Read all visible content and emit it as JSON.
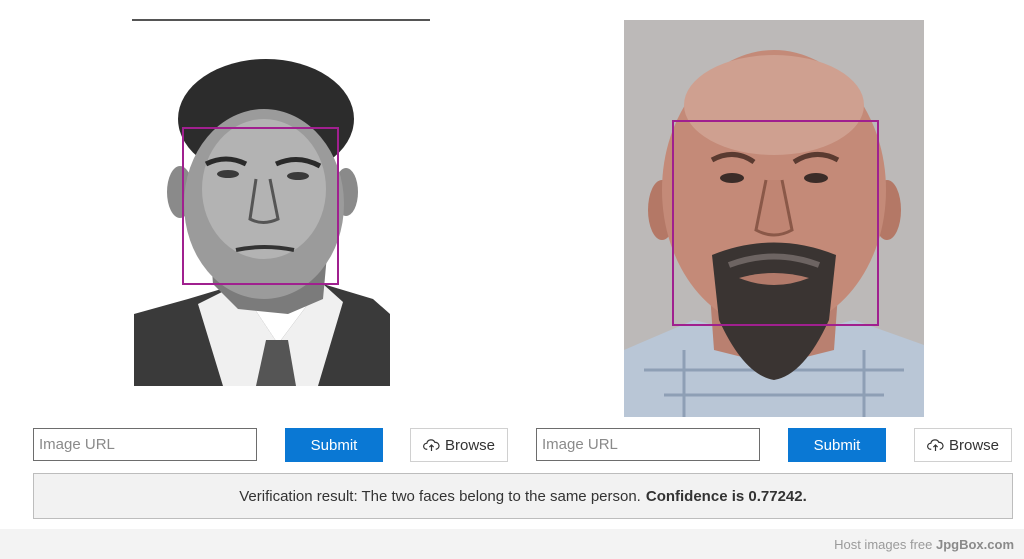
{
  "left_panel": {
    "image_alt": "ID document photo of a man in suit and tie",
    "url_placeholder": "Image URL",
    "submit_label": "Submit",
    "browse_label": "Browse"
  },
  "right_panel": {
    "image_alt": "Photo of a bald man with goatee",
    "url_placeholder": "Image URL",
    "submit_label": "Submit",
    "browse_label": "Browse"
  },
  "result": {
    "prefix": "Verification result: The two faces belong to the same person.",
    "confidence": "Confidence is 0.77242."
  },
  "footer": {
    "text": "Host images free",
    "brand": "JpgBox.com"
  },
  "colors": {
    "face_box": "#a0208f",
    "submit_bg": "#0a78d4"
  },
  "icons": {
    "browse": "cloud-upload-icon"
  }
}
